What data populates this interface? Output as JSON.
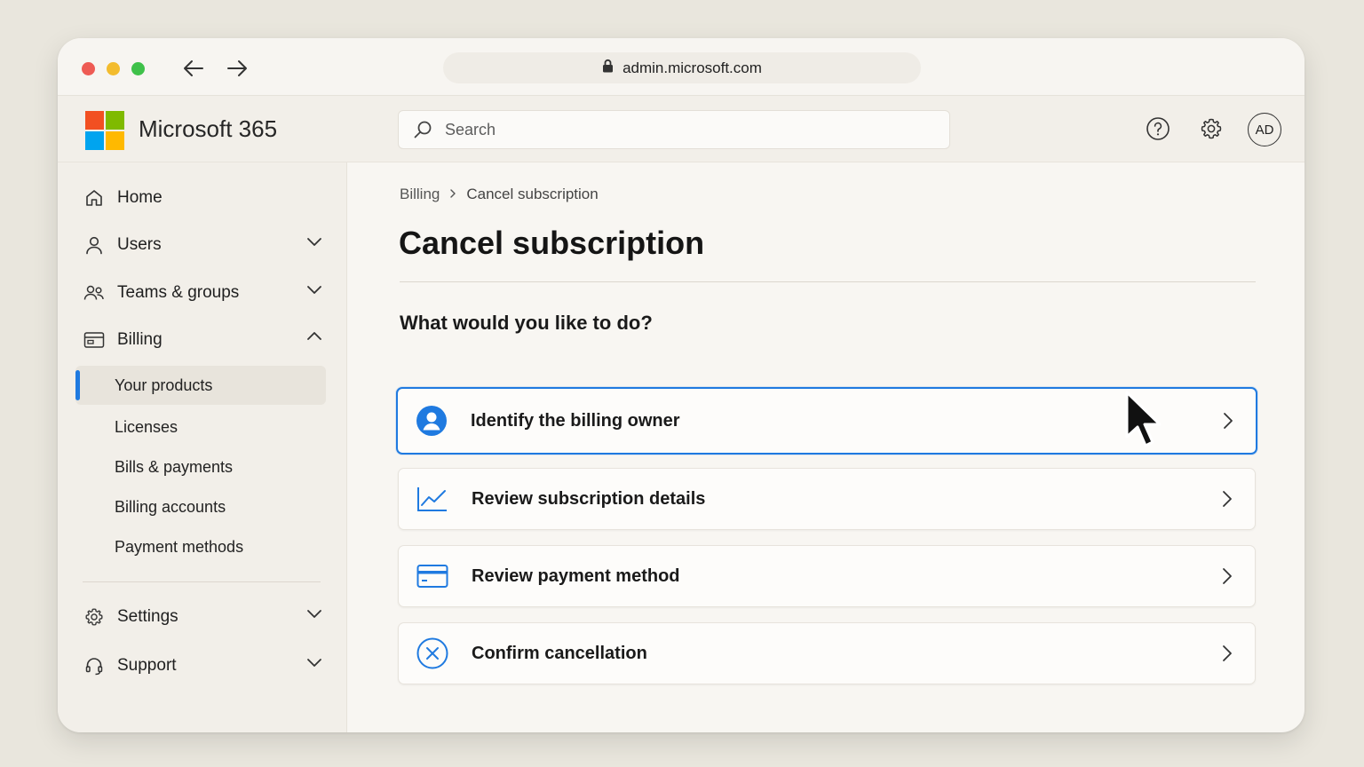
{
  "browser": {
    "url": "admin.microsoft.com"
  },
  "header": {
    "brand": "Microsoft 365",
    "search_placeholder": "Search",
    "avatar_initials": "AD"
  },
  "sidebar": {
    "items": [
      {
        "label": "Home",
        "icon": "home-icon"
      },
      {
        "label": "Users",
        "icon": "user-icon",
        "expandable": true
      },
      {
        "label": "Teams & groups",
        "icon": "people-icon",
        "expandable": true
      },
      {
        "label": "Billing",
        "icon": "billing-icon",
        "expanded": true
      },
      {
        "label": "Settings",
        "icon": "gear-icon",
        "expandable": true
      },
      {
        "label": "Support",
        "icon": "headset-icon",
        "expandable": true
      }
    ],
    "billing_subitems": [
      {
        "label": "Your products",
        "active": true
      },
      {
        "label": "Licenses"
      },
      {
        "label": "Bills & payments"
      },
      {
        "label": "Billing accounts"
      },
      {
        "label": "Payment methods"
      }
    ]
  },
  "main": {
    "breadcrumb": [
      "Billing",
      "Cancel subscription"
    ],
    "title": "Cancel subscription",
    "question": "What would you like to do?",
    "options": [
      {
        "label": "Identify the billing owner",
        "icon": "person-circle-icon",
        "selected": true
      },
      {
        "label": "Review subscription details",
        "icon": "line-chart-icon"
      },
      {
        "label": "Review payment method",
        "icon": "credit-card-icon"
      },
      {
        "label": "Confirm cancellation",
        "icon": "close-circle-icon"
      }
    ]
  },
  "colors": {
    "accent": "#1f7ae0",
    "logo_red": "#f25022",
    "logo_green": "#7fba00",
    "logo_blue": "#00a4ef",
    "logo_yellow": "#ffb900"
  }
}
